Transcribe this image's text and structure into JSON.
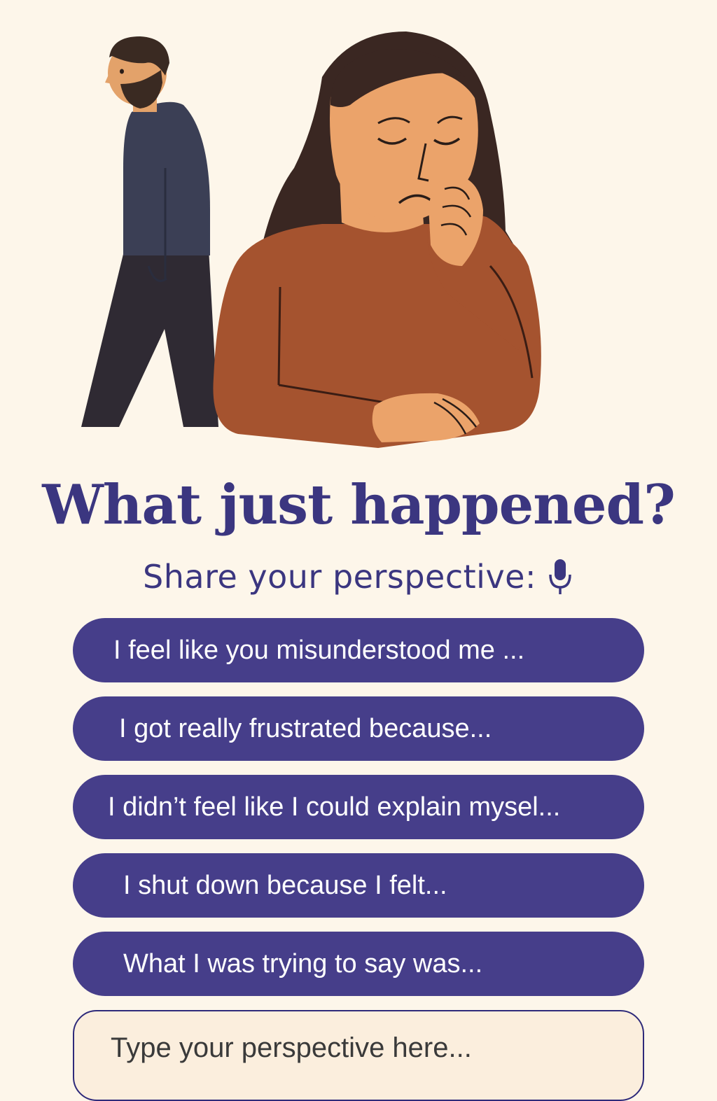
{
  "title": "What just happened?",
  "subtitle": "Share your perspective:",
  "icons": {
    "mic": "microphone-icon"
  },
  "prompts": [
    "I feel like you misunderstood me ...",
    "I got really frustrated because...",
    "I didn’t feel like I could explain mysel...",
    "I shut down because I felt...",
    "What I was trying to say was..."
  ],
  "input": {
    "placeholder": "Type your perspective here...",
    "value": ""
  },
  "colors": {
    "background": "#fdf6ea",
    "accent": "#463e8a",
    "title": "#3b3680",
    "input_background": "#fbeedd"
  }
}
